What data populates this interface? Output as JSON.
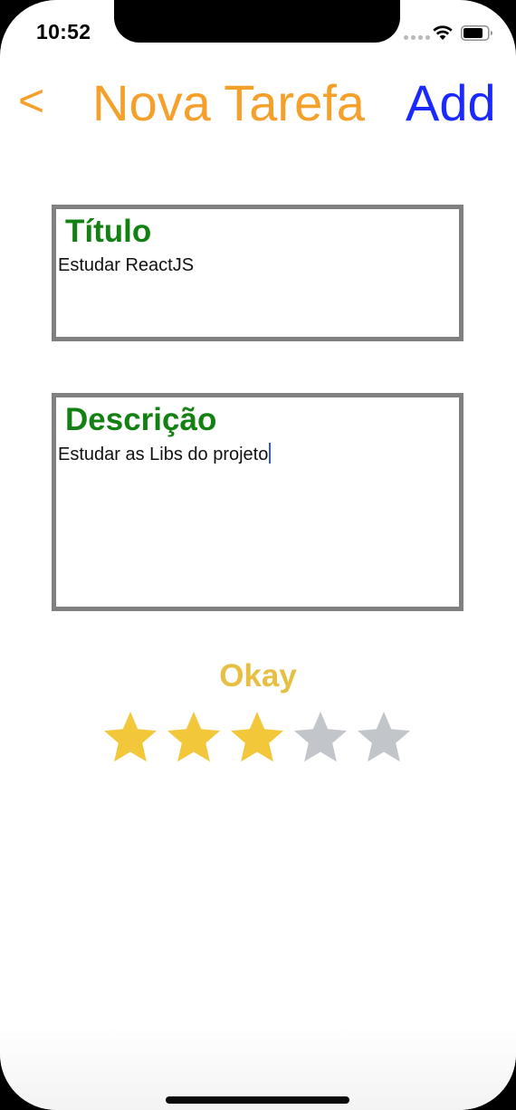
{
  "status_bar": {
    "time": "10:52"
  },
  "nav": {
    "back_label": "<",
    "title": "Nova Tarefa",
    "add_label": "Add"
  },
  "form": {
    "title_field": {
      "label": "Título",
      "value": "Estudar ReactJS"
    },
    "description_field": {
      "label": "Descrição",
      "value": "Estudar as Libs do projeto"
    }
  },
  "rating": {
    "label": "Okay",
    "value": 3,
    "max": 5,
    "filled_color": "#f3c73a",
    "empty_color": "#c2c6cb"
  },
  "colors": {
    "nav_accent": "#f5a02a",
    "add_button": "#1a2aff",
    "field_label": "#138013",
    "field_border": "#808080",
    "rating_label": "#e6bf43"
  },
  "icons": [
    "wifi-icon",
    "battery-icon",
    "signal-dots-icon",
    "star-icon"
  ]
}
